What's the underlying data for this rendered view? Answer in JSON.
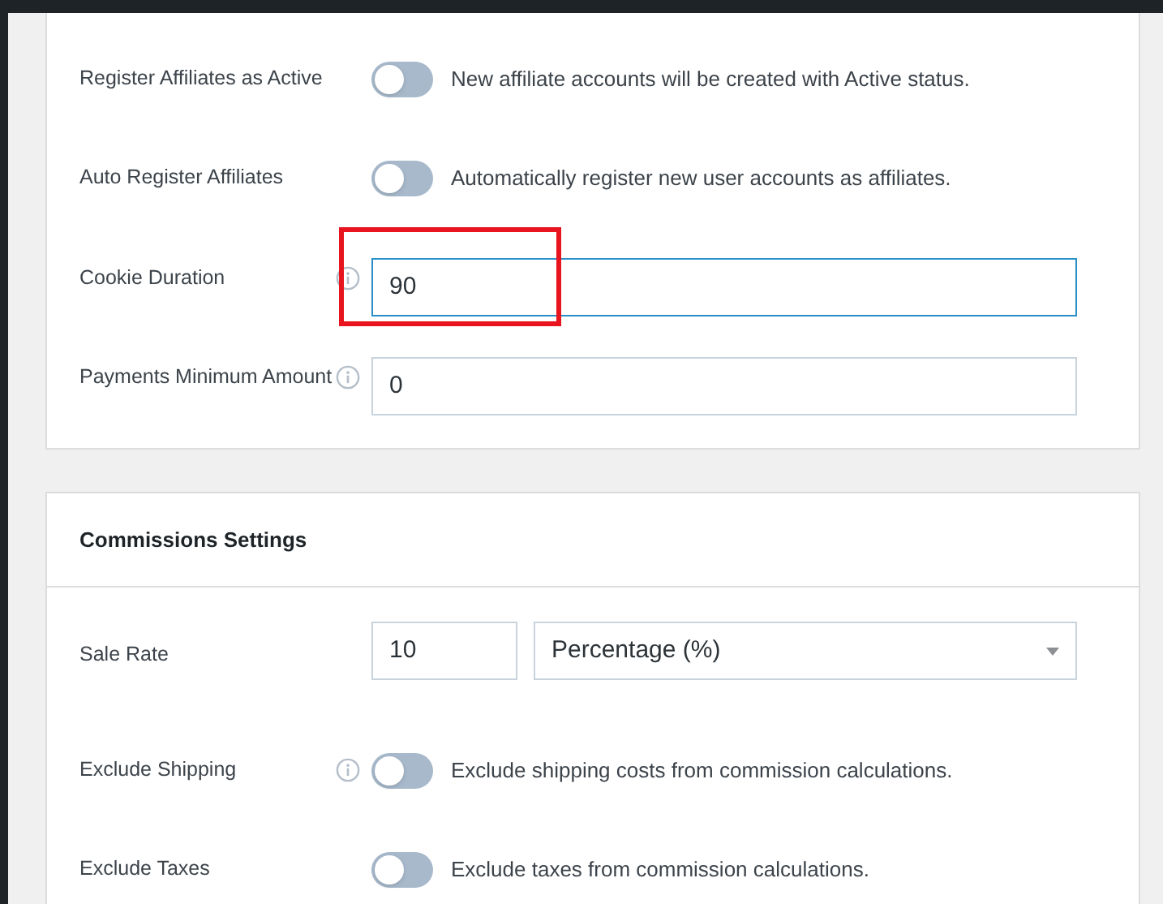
{
  "general_settings": {
    "rows": [
      {
        "kind": "toggle",
        "label": "Register Affiliates as Active",
        "info": false,
        "on": false,
        "description": "New affiliate accounts will be created with Active status."
      },
      {
        "kind": "toggle",
        "label": "Auto Register Affiliates",
        "info": false,
        "on": false,
        "description": "Automatically register new user accounts as affiliates."
      },
      {
        "kind": "input",
        "label": "Cookie Duration",
        "info": true,
        "value": "90",
        "focused": true,
        "highlighted": true
      },
      {
        "kind": "input",
        "label": "Payments Minimum Amount",
        "info": true,
        "value": "0",
        "focused": false,
        "highlighted": false
      }
    ]
  },
  "commissions_settings": {
    "title": "Commissions Settings",
    "rows": [
      {
        "kind": "rate",
        "label": "Sale Rate",
        "info": false,
        "value": "10",
        "rate_type": "Percentage (%)"
      },
      {
        "kind": "toggle",
        "label": "Exclude Shipping",
        "info": true,
        "on": false,
        "description": "Exclude shipping costs from commission calculations."
      },
      {
        "kind": "toggle",
        "label": "Exclude Taxes",
        "info": false,
        "on": false,
        "description": "Exclude taxes from commission calculations."
      }
    ]
  }
}
